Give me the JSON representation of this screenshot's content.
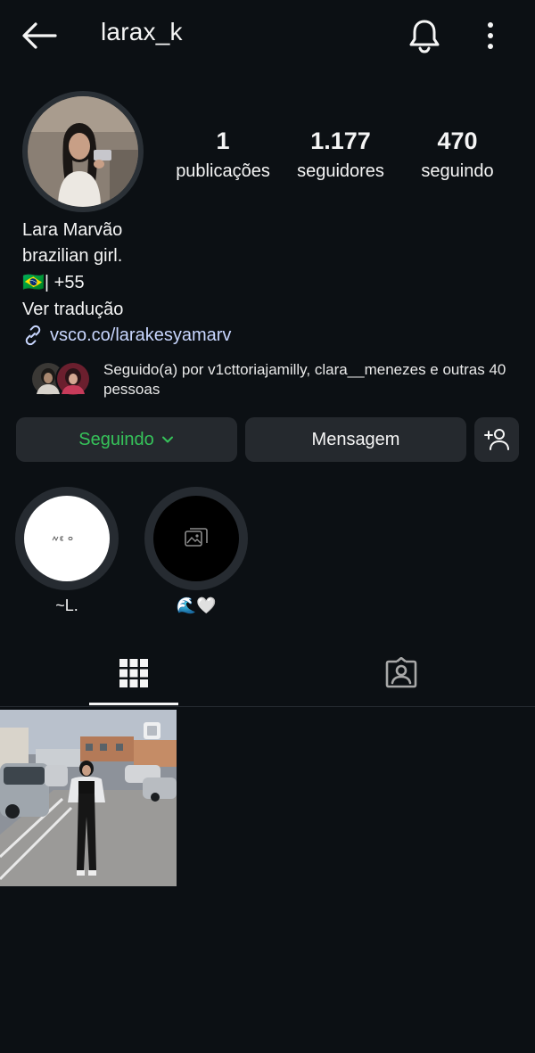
{
  "header": {
    "username": "larax_k",
    "icons": [
      "back-arrow-icon",
      "bell-icon",
      "more-vertical-icon"
    ]
  },
  "stats": {
    "posts": {
      "value": "1",
      "label": "publicações"
    },
    "followers": {
      "value": "1.177",
      "label": "seguidores"
    },
    "following": {
      "value": "470",
      "label": "seguindo"
    }
  },
  "bio": {
    "name": "Lara Marvão",
    "line1": "brazilian girl.",
    "line2": "🇧🇷| +55",
    "translate": "Ver tradução",
    "link": "vsco.co/larakesyamarv"
  },
  "followed_by": {
    "text": "Seguido(a) por v1cttoriajamilly, clara__menezes e outras 40 pessoas"
  },
  "actions": {
    "following_label": "Seguindo",
    "message_label": "Mensagem"
  },
  "highlights": [
    {
      "label": "~L."
    },
    {
      "label": "🌊🤍"
    }
  ],
  "tabs": [
    "grid-icon",
    "tagged-icon"
  ],
  "colors": {
    "background": "#0c1014",
    "button": "#25292e",
    "following_green": "#36c35a",
    "link": "#c9d7ff"
  }
}
